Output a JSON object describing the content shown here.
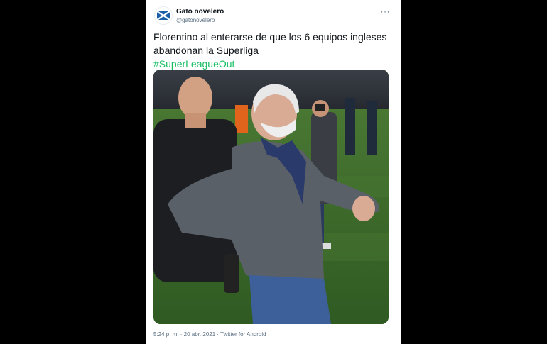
{
  "tweet": {
    "display_name": "Gato novelero",
    "handle": "@gatonovelero",
    "text": "Florentino al enterarse de que los 6 equipos ingleses abandonan la Superliga",
    "hashtag": "#SuperLeagueOut",
    "timestamp": "5:24 p. m. · 20 abr. 2021 · Twitter for Android",
    "more_glyph": "···"
  },
  "colors": {
    "hashtag": "#17bf63",
    "text": "#0f1419",
    "secondary": "#5b7083"
  }
}
